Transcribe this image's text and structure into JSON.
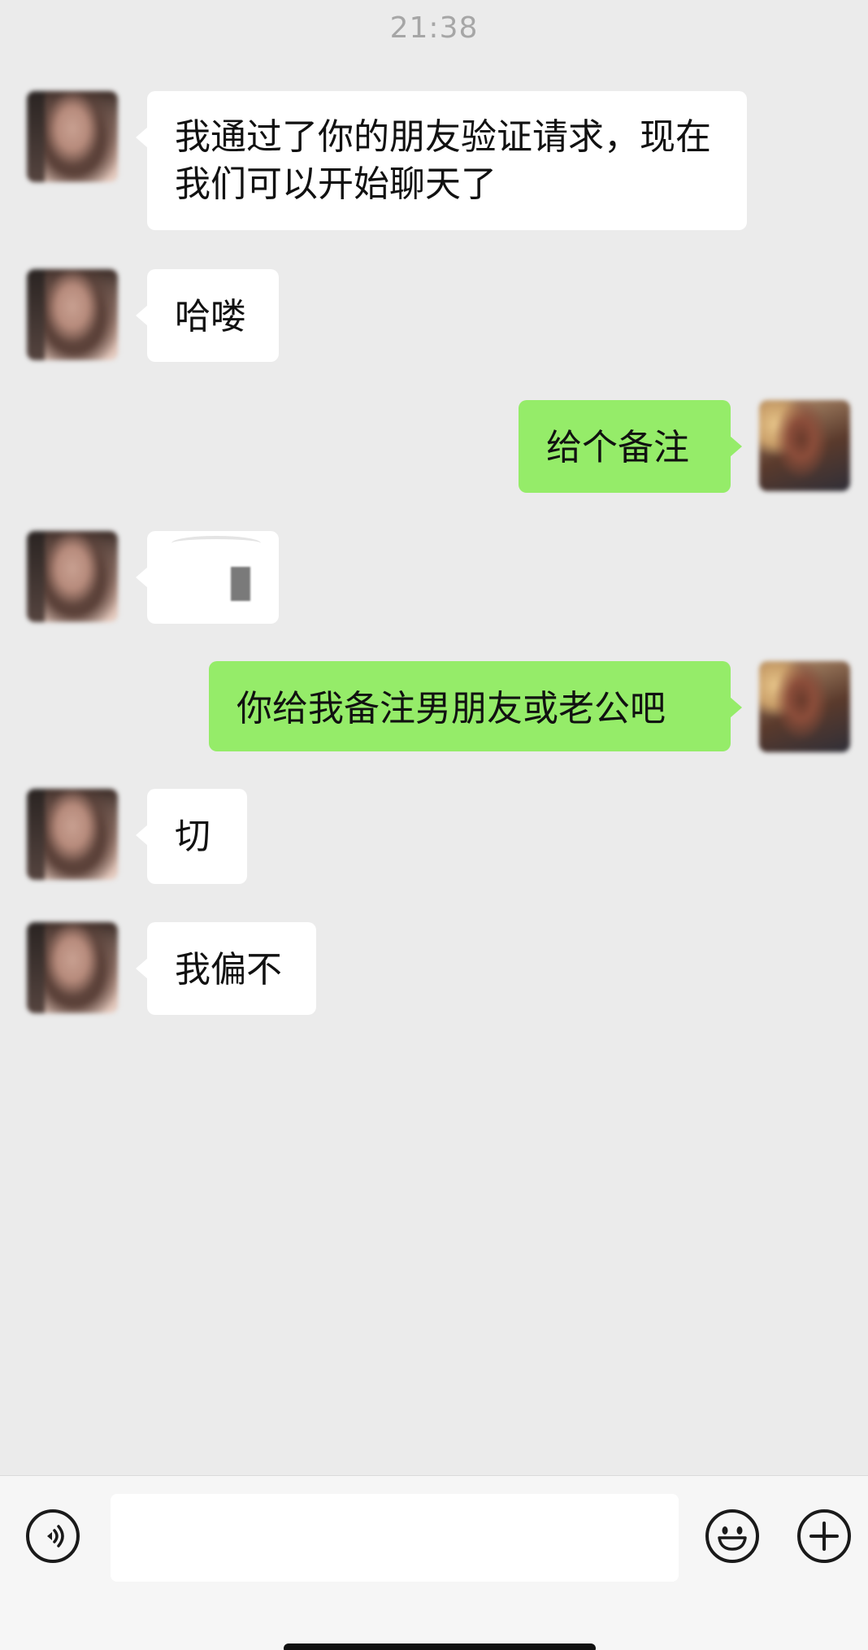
{
  "chat": {
    "timestamp": "21:38",
    "messages": [
      {
        "direction": "incoming",
        "text": "我通过了你的朋友验证请求，现在我们可以开始聊天了"
      },
      {
        "direction": "incoming",
        "text": "哈喽"
      },
      {
        "direction": "outgoing",
        "text": "给个备注"
      },
      {
        "direction": "incoming",
        "text": "",
        "kind": "sticker"
      },
      {
        "direction": "outgoing",
        "text": "你给我备注男朋友或老公吧"
      },
      {
        "direction": "incoming",
        "text": "切"
      },
      {
        "direction": "incoming",
        "text": "我偏不"
      }
    ]
  },
  "input_bar": {
    "message_value": "",
    "voice_icon": "voice-icon",
    "emoji_icon": "smiley-icon",
    "more_icon": "plus-icon"
  },
  "colors": {
    "background": "#ebebeb",
    "incoming_bubble": "#ffffff",
    "outgoing_bubble": "#95ec69",
    "timestamp": "#a6a6a6"
  }
}
